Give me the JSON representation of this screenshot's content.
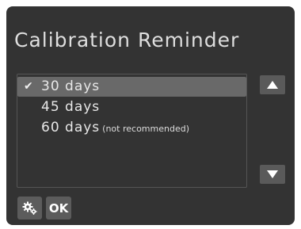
{
  "screen": {
    "title": "Calibration Reminder"
  },
  "options": [
    {
      "label": "30 days",
      "note": "",
      "selected": true
    },
    {
      "label": "45 days",
      "note": "",
      "selected": false
    },
    {
      "label": "60 days",
      "note": "(not recommended)",
      "selected": false
    }
  ],
  "selection_marker": "✔",
  "scroll": {
    "up_icon": "scroll-up-icon",
    "down_icon": "scroll-down-icon"
  },
  "footer": {
    "settings_icon": "gears-icon",
    "ok_label": "OK"
  },
  "colors": {
    "background": "#333333",
    "selected_row": "#696969",
    "button": "#5c5c5c",
    "text": "#e8e8e8"
  }
}
